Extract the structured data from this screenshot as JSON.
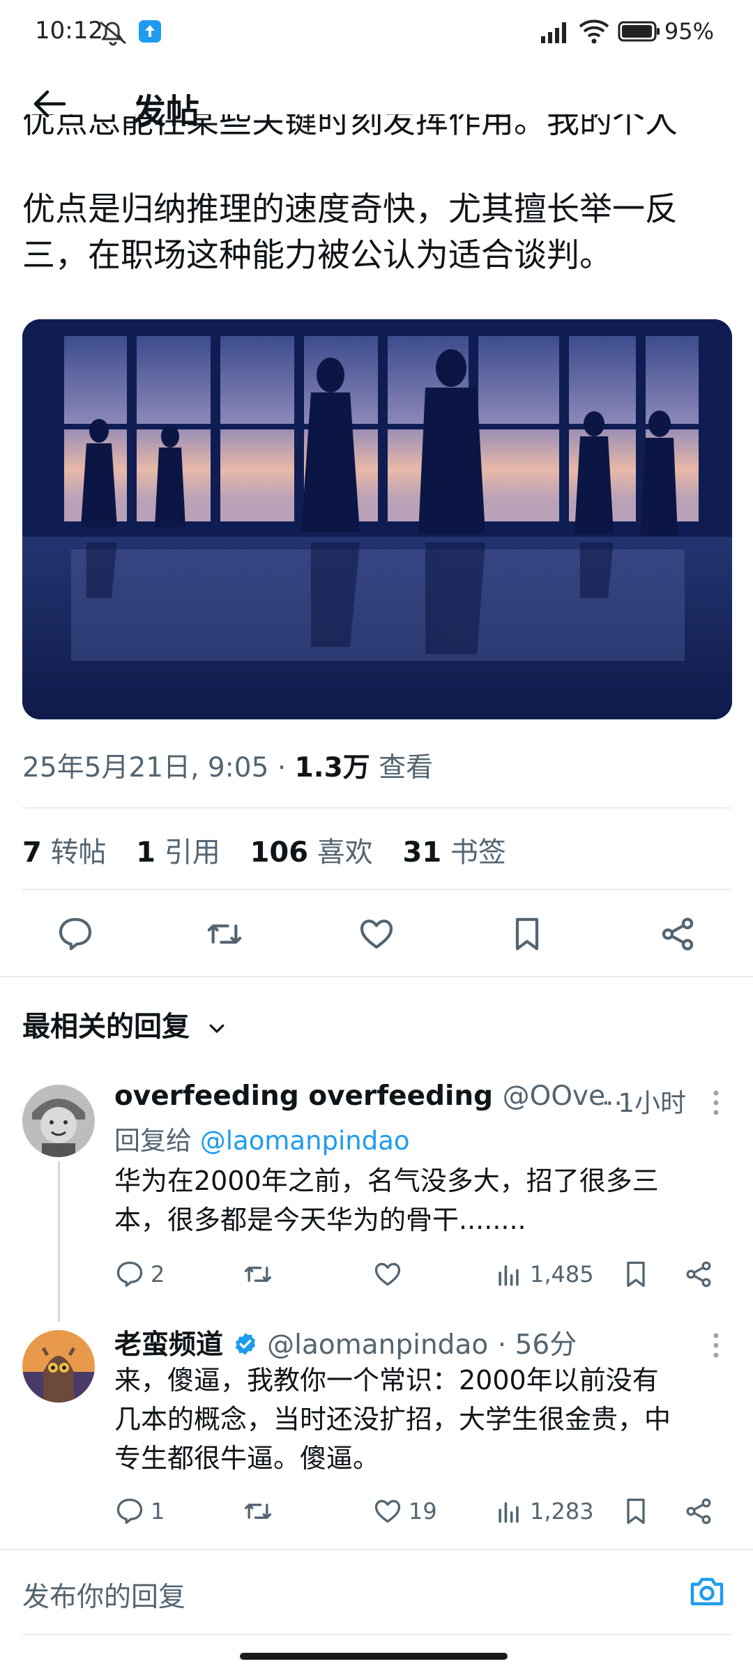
{
  "status_bar": {
    "time": "10:12",
    "battery": "95%"
  },
  "header": {
    "title": "发帖"
  },
  "post": {
    "text_lines": [
      "优点总能在某些关键时刻发挥作用。我的个人",
      "优点是归纳推理的速度奇快，尤其擅长举一反",
      "三，在职场这种能力被公认为适合谈判。"
    ],
    "meta": {
      "date": "25年5月21日, 9:05 · ",
      "views": "1.3万",
      "views_label": " 查看"
    },
    "stats": [
      {
        "count": "7",
        "label": "转帖"
      },
      {
        "count": "1",
        "label": "引用"
      },
      {
        "count": "106",
        "label": "喜欢"
      },
      {
        "count": "31",
        "label": "书签"
      }
    ]
  },
  "sort": {
    "label": "最相关的回复"
  },
  "replies": [
    {
      "name": "overfeeding overfeeding",
      "handle": "@OOve...",
      "time": "· 1小时",
      "replying_prefix": "回复给 ",
      "replying_to": "@laomanpindao",
      "body_lines": [
        "华为在2000年之前，名气没多大，招了很多三",
        "本，很多都是今天华为的骨干........"
      ],
      "replies": "2",
      "likes": "",
      "views": "1,485"
    },
    {
      "name": "老蛮频道",
      "handle": "@laomanpindao",
      "time": "· 56分",
      "body_lines": [
        "来，傻逼，我教你一个常识：2000年以前没有",
        "几本的概念，当时还没扩招，大学生很金贵，中",
        "专生都很牛逼。傻逼。"
      ],
      "replies": "1",
      "likes": "19",
      "views": "1,283"
    }
  ],
  "compose": {
    "placeholder": "发布你的回复"
  },
  "colors": {
    "accent": "#1d9bf0",
    "secondary_text": "#536471",
    "verified": "#1d9bf0"
  }
}
